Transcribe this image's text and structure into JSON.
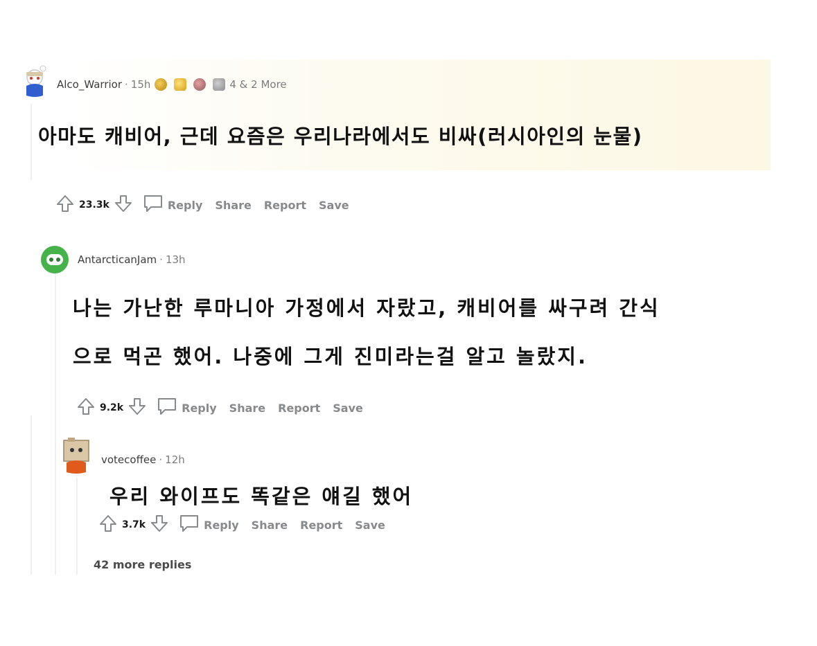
{
  "colors": {
    "text": "#111111",
    "meta": "#7c7c7c",
    "action": "#878a8c",
    "thread_line": "#edeff1",
    "highlight": "#fdf8e4"
  },
  "comments": [
    {
      "username": "Alco_Warrior",
      "time": "15h",
      "awards_more": "4 & 2 More",
      "avatar_icon": "snoo-avatar-icon",
      "body_lines": [
        "아마도 캐비어, 근데 요즘은 우리나라에서도 비싸(러시아인의 눈물)"
      ],
      "score": "23.3k",
      "reply_label": "Reply",
      "share_label": "Share",
      "report_label": "Report",
      "save_label": "Save"
    },
    {
      "username": "AntarcticanJam",
      "time": "13h",
      "avatar_icon": "green-robot-avatar-icon",
      "body_lines": [
        "나는 가난한 루마니아 가정에서 자랐고, 캐비어를 싸구려 간식",
        "으로 먹곤 했어. 나중에 그게 진미라는걸 알고 놀랐지."
      ],
      "score": "9.2k",
      "reply_label": "Reply",
      "share_label": "Share",
      "report_label": "Report",
      "save_label": "Save"
    },
    {
      "username": "votecoffee",
      "time": "12h",
      "avatar_icon": "box-avatar-icon",
      "body_lines": [
        "우리 와이프도 똑같은 얘길 했어"
      ],
      "score": "3.7k",
      "reply_label": "Reply",
      "share_label": "Share",
      "report_label": "Report",
      "save_label": "Save"
    }
  ],
  "more_replies": "42 more replies"
}
